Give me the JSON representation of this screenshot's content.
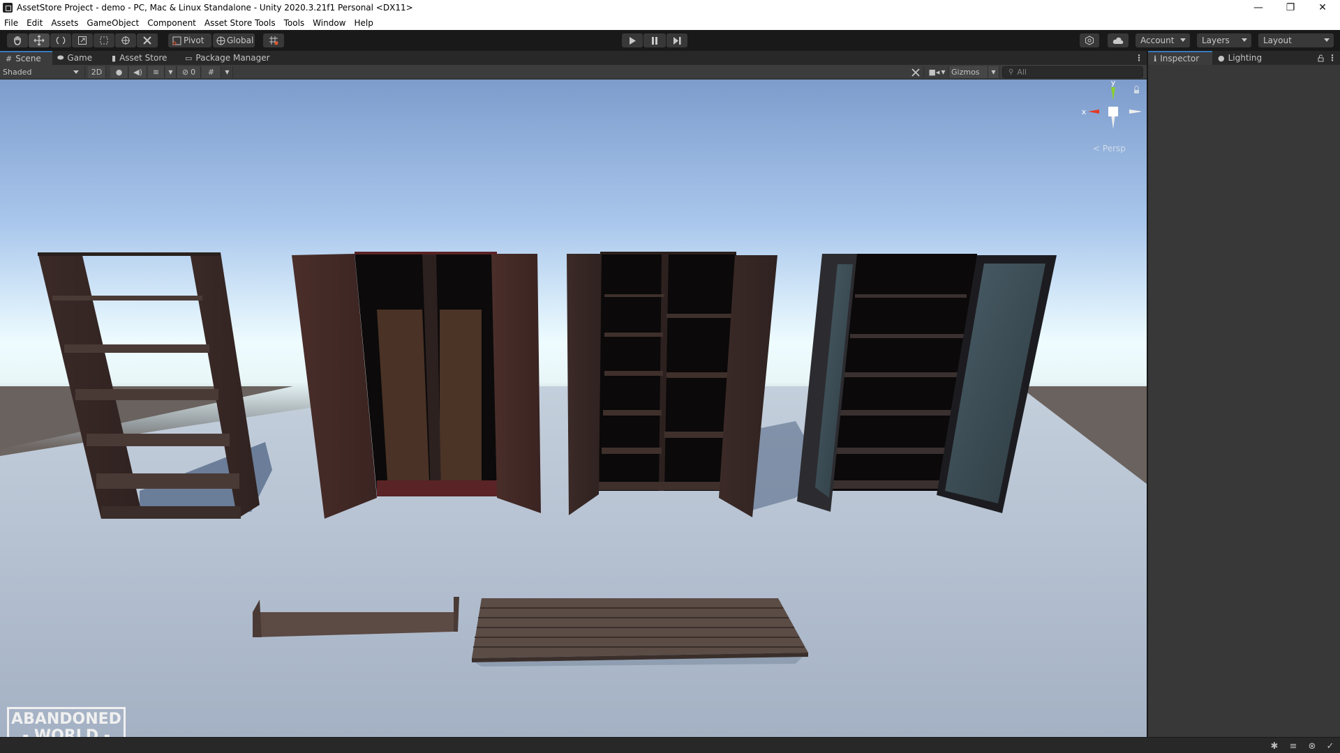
{
  "window": {
    "title": "AssetStore Project - demo - PC, Mac & Linux Standalone - Unity 2020.3.21f1 Personal <DX11>",
    "controls": {
      "minimize": "—",
      "restore": "❐",
      "close": "✕"
    }
  },
  "menubar": {
    "items": [
      "File",
      "Edit",
      "Assets",
      "GameObject",
      "Component",
      "Asset Store Tools",
      "Tools",
      "Window",
      "Help"
    ]
  },
  "toolbar": {
    "tools": [
      {
        "name": "hand-tool",
        "active": false
      },
      {
        "name": "move-tool",
        "active": true
      },
      {
        "name": "rotate-tool",
        "active": false
      },
      {
        "name": "scale-tool",
        "active": false
      },
      {
        "name": "rect-tool",
        "active": false
      },
      {
        "name": "transform-tool",
        "active": false
      },
      {
        "name": "custom-tool",
        "active": false
      }
    ],
    "pivot_label": "Pivot",
    "global_label": "Global",
    "account_label": "Account",
    "layers_label": "Layers",
    "layout_label": "Layout"
  },
  "tabs": {
    "left": [
      {
        "label": "Scene",
        "icon": "#",
        "active": true
      },
      {
        "label": "Game",
        "icon": "🎮",
        "active": false
      },
      {
        "label": "Asset Store",
        "icon": "🛍",
        "active": false
      },
      {
        "label": "Package Manager",
        "icon": "▭",
        "active": false
      }
    ],
    "right": [
      {
        "label": "Inspector",
        "icon": "ℹ",
        "active": true
      },
      {
        "label": "Lighting",
        "icon": "💡",
        "active": false
      }
    ]
  },
  "scenebar": {
    "shading_mode": "Shaded",
    "mode_2d": "2D",
    "hidden_count": "0",
    "gizmos_label": "Gizmos",
    "search_placeholder": "All"
  },
  "scene": {
    "gizmo": {
      "y_label": "y",
      "x_label": "x",
      "projection": "Persp"
    },
    "watermark": {
      "line1": "ABANDONED",
      "line2": "- WORLD -"
    },
    "colors": {
      "sky_top": "#7d9ccc",
      "horizon": "#eefcff",
      "ground_far": "#6b635f",
      "floor": "#b7c3d3",
      "wood": "#3e2a27"
    }
  }
}
